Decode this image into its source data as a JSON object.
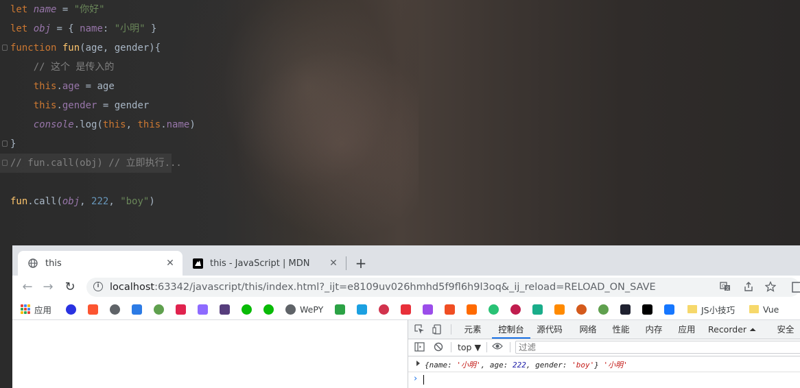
{
  "editor": {
    "lines": [
      {
        "parts": [
          [
            "kw",
            "let "
          ],
          [
            "var",
            "name"
          ],
          [
            "pl",
            " = "
          ],
          [
            "str",
            "\"你好\""
          ]
        ]
      },
      {
        "parts": [
          [
            "kw",
            "let "
          ],
          [
            "var",
            "obj"
          ],
          [
            "pl",
            " = { "
          ],
          [
            "prop",
            "name"
          ],
          [
            "pl",
            ": "
          ],
          [
            "str",
            "\"小明\""
          ],
          [
            "pl",
            " }"
          ]
        ]
      },
      {
        "parts": [
          [
            "kw",
            "function "
          ],
          [
            "fn",
            "fun"
          ],
          [
            "pl",
            "(age, gender){"
          ]
        ]
      },
      {
        "parts": [
          [
            "pl",
            "    "
          ],
          [
            "cmt",
            "// 这个 是传入的"
          ]
        ]
      },
      {
        "parts": [
          [
            "pl",
            "    "
          ],
          [
            "kw",
            "this"
          ],
          [
            "pl",
            "."
          ],
          [
            "prop",
            "age"
          ],
          [
            "pl",
            " = age"
          ]
        ]
      },
      {
        "parts": [
          [
            "pl",
            "    "
          ],
          [
            "kw",
            "this"
          ],
          [
            "pl",
            "."
          ],
          [
            "prop",
            "gender"
          ],
          [
            "pl",
            " = gender"
          ]
        ]
      },
      {
        "parts": [
          [
            "pl",
            "    "
          ],
          [
            "glob",
            "console"
          ],
          [
            "pl",
            ".log("
          ],
          [
            "kw",
            "this"
          ],
          [
            "pl",
            ", "
          ],
          [
            "kw",
            "this"
          ],
          [
            "pl",
            "."
          ],
          [
            "prop",
            "name"
          ],
          [
            "pl",
            ")"
          ]
        ]
      },
      {
        "parts": [
          [
            "pl",
            "}"
          ]
        ]
      },
      {
        "parts": [
          [
            "cmt",
            "// fun.call(obj) // 立即执行..."
          ]
        ]
      },
      {
        "parts": [
          [
            "pl",
            ""
          ]
        ]
      },
      {
        "parts": [
          [
            "fn",
            "fun"
          ],
          [
            "pl",
            ".call("
          ],
          [
            "var",
            "obj"
          ],
          [
            "pl",
            ", "
          ],
          [
            "num",
            "222"
          ],
          [
            "pl",
            ", "
          ],
          [
            "str",
            "\"boy\""
          ],
          [
            "pl",
            ")"
          ]
        ]
      }
    ]
  },
  "browser": {
    "tabs": [
      {
        "title": "this",
        "close": "✕"
      },
      {
        "title": "this - JavaScript | MDN",
        "close": "✕"
      }
    ],
    "new_tab": "+",
    "nav": {
      "back": "←",
      "forward": "→",
      "reload": "↻"
    },
    "url": {
      "host": "localhost",
      "rest": ":63342/javascript/this/index.html?_ijt=e8109uv026hmhd5f9fl6h9l3oq&_ij_reload=RELOAD_ON_SAVE"
    },
    "bookmarks": [
      {
        "label": "应用",
        "icon": "apps-grid"
      },
      {
        "label": "",
        "icon": "baidu-paw",
        "color": "#2932e1"
      },
      {
        "label": "",
        "icon": "csdn-icon",
        "color": "#fc5531"
      },
      {
        "label": "",
        "icon": "globe-icon",
        "color": "#5f6368"
      },
      {
        "label": "",
        "icon": "layers-icon",
        "color": "#2c7be5"
      },
      {
        "label": "",
        "icon": "node-icon",
        "color": "#5fa04e"
      },
      {
        "label": "",
        "icon": "nest-icon",
        "color": "#e0234e"
      },
      {
        "label": "",
        "icon": "vite-icon",
        "color": "#8e6bff"
      },
      {
        "label": "",
        "icon": "bootstrap-icon",
        "color": "#563d7c"
      },
      {
        "label": "",
        "icon": "wechat-icon",
        "color": "#09bb07"
      },
      {
        "label": "",
        "icon": "wechat-icon-2",
        "color": "#09bb07"
      },
      {
        "label": "WePY",
        "icon": "globe-icon",
        "color": "#5f6368"
      },
      {
        "label": "",
        "icon": "grid-icon",
        "color": "#2ba245"
      },
      {
        "label": "",
        "icon": "stack-icon",
        "color": "#1ba0e1"
      },
      {
        "label": "",
        "icon": "record-icon",
        "color": "#d1334d"
      },
      {
        "label": "",
        "icon": "s-red-icon",
        "color": "#e8303a"
      },
      {
        "label": "",
        "icon": "s-purple-icon",
        "color": "#9b4dea"
      },
      {
        "label": "",
        "icon": "fox-icon",
        "color": "#f04e23"
      },
      {
        "label": "",
        "icon": "flag-icon",
        "color": "#ff6a00"
      },
      {
        "label": "",
        "icon": "q-icon",
        "color": "#29c275"
      },
      {
        "label": "",
        "icon": "circle-icon",
        "color": "#c01d4e"
      },
      {
        "label": "",
        "icon": "hex-icon",
        "color": "#1aad8a"
      },
      {
        "label": "",
        "icon": "b-orange-icon",
        "color": "#ff8a00"
      },
      {
        "label": "",
        "icon": "lion-icon",
        "color": "#d45a1c"
      },
      {
        "label": "",
        "icon": "node-icon-2",
        "color": "#5fa04e"
      },
      {
        "label": "",
        "icon": "leaf-icon",
        "color": "#1f2130"
      },
      {
        "label": "",
        "icon": "mdn-icon",
        "color": "#000000"
      },
      {
        "label": "",
        "icon": "b-blue-icon",
        "color": "#1677ff"
      },
      {
        "label": "JS小技巧",
        "icon": "folder-icon"
      },
      {
        "label": "Vue",
        "icon": "folder-icon"
      }
    ]
  },
  "devtools": {
    "tabs": [
      "元素",
      "控制台",
      "源代码",
      "网络",
      "性能",
      "内存",
      "应用",
      "Recorder ⏶",
      "安全"
    ],
    "active_tab": "控制台",
    "context": "top ▼",
    "filter_placeholder": "过滤",
    "log": {
      "open": "{",
      "k1": "name",
      "v1": "'小明'",
      "k2": "age",
      "v2": "222",
      "k3": "gender",
      "v3": "'boy'",
      "close": "}",
      "extra": "'小明'"
    },
    "prompt": "›"
  },
  "colors": {
    "accent": "#1a73e8",
    "editor_bg": "#2b2b2b"
  }
}
